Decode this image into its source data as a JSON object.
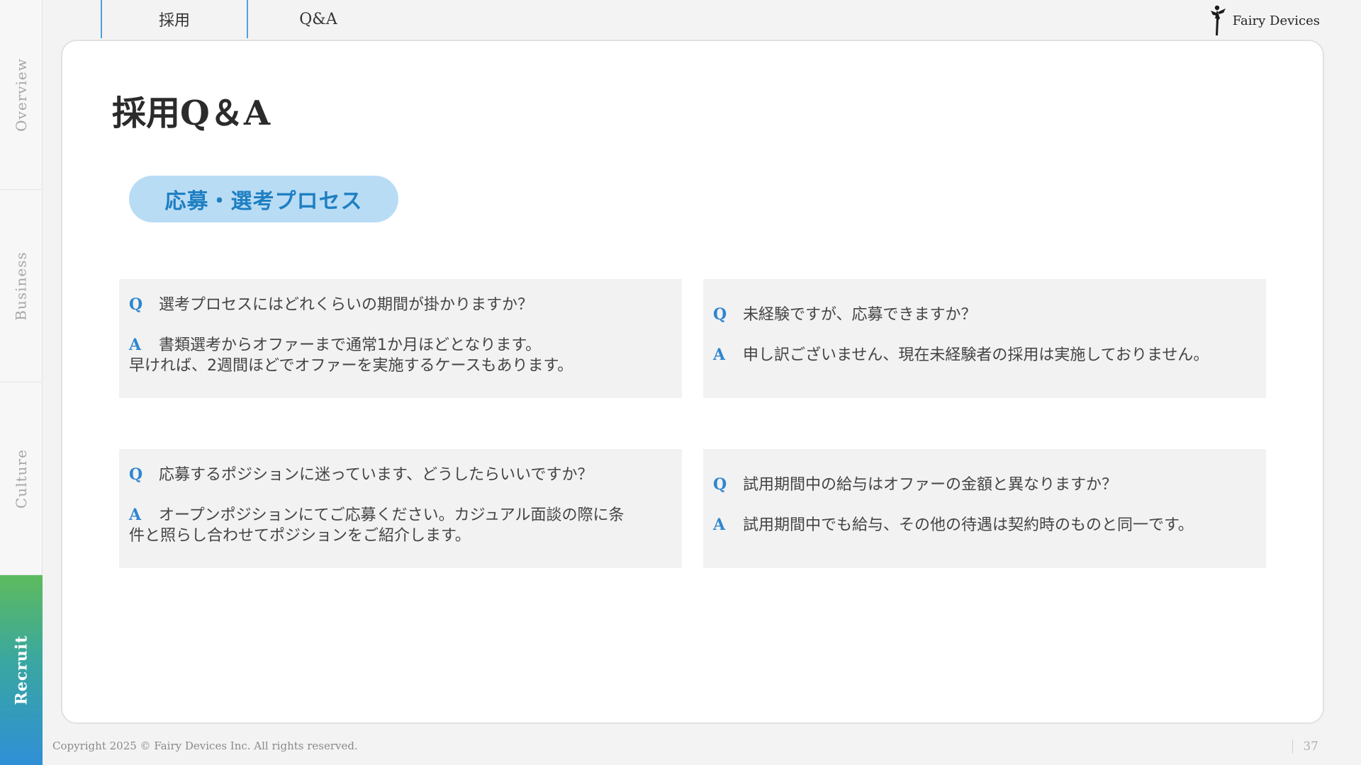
{
  "side_nav": {
    "items": [
      {
        "label": "Overview",
        "active": false
      },
      {
        "label": "Business",
        "active": false
      },
      {
        "label": "Culture",
        "active": false
      },
      {
        "label": "Recruit",
        "active": true
      }
    ]
  },
  "top_tabs": [
    {
      "label": "採用"
    },
    {
      "label": "Q&A"
    }
  ],
  "logo": {
    "text": "Fairy Devices",
    "icon": "fairy-figure-icon"
  },
  "page": {
    "title": "採用Q＆A",
    "section_label": "応募・選考プロセス"
  },
  "qa_items": [
    {
      "q_mark": "Q",
      "question": "選考プロセスにはどれくらいの期間が掛かりますか？",
      "a_mark": "A",
      "answer_line1": "書類選考からオファーまで通常1か月ほどとなります。",
      "answer_line2": "早ければ、2週間ほどでオファーを実施するケースもあります。"
    },
    {
      "q_mark": "Q",
      "question": "未経験ですが、応募できますか？",
      "a_mark": "A",
      "answer_line1": "申し訳ございません、現在未経験者の採用は実施しておりません。",
      "answer_line2": ""
    },
    {
      "q_mark": "Q",
      "question": "応募するポジションに迷っています、どうしたらいいですか？",
      "a_mark": "A",
      "answer_line1": "オープンポジションにてご応募ください。カジュアル面談の際に条",
      "answer_line2": "件と照らし合わせてポジションをご紹介します。"
    },
    {
      "q_mark": "Q",
      "question": "試用期間中の給与はオファーの金額と異なりますか？",
      "a_mark": "A",
      "answer_line1": "試用期間中でも給与、その他の待遇は契約時のものと同一です。",
      "answer_line2": ""
    }
  ],
  "footer": {
    "copyright": "Copyright  2025 © Fairy Devices Inc. All rights reserved.",
    "page_number": "37"
  },
  "colors": {
    "accent_blue": "#2f86d0",
    "pill_bg": "#b9dcf5",
    "recruit_gradient_top": "#5dbb5d",
    "recruit_gradient_bottom": "#2f8fd6"
  }
}
